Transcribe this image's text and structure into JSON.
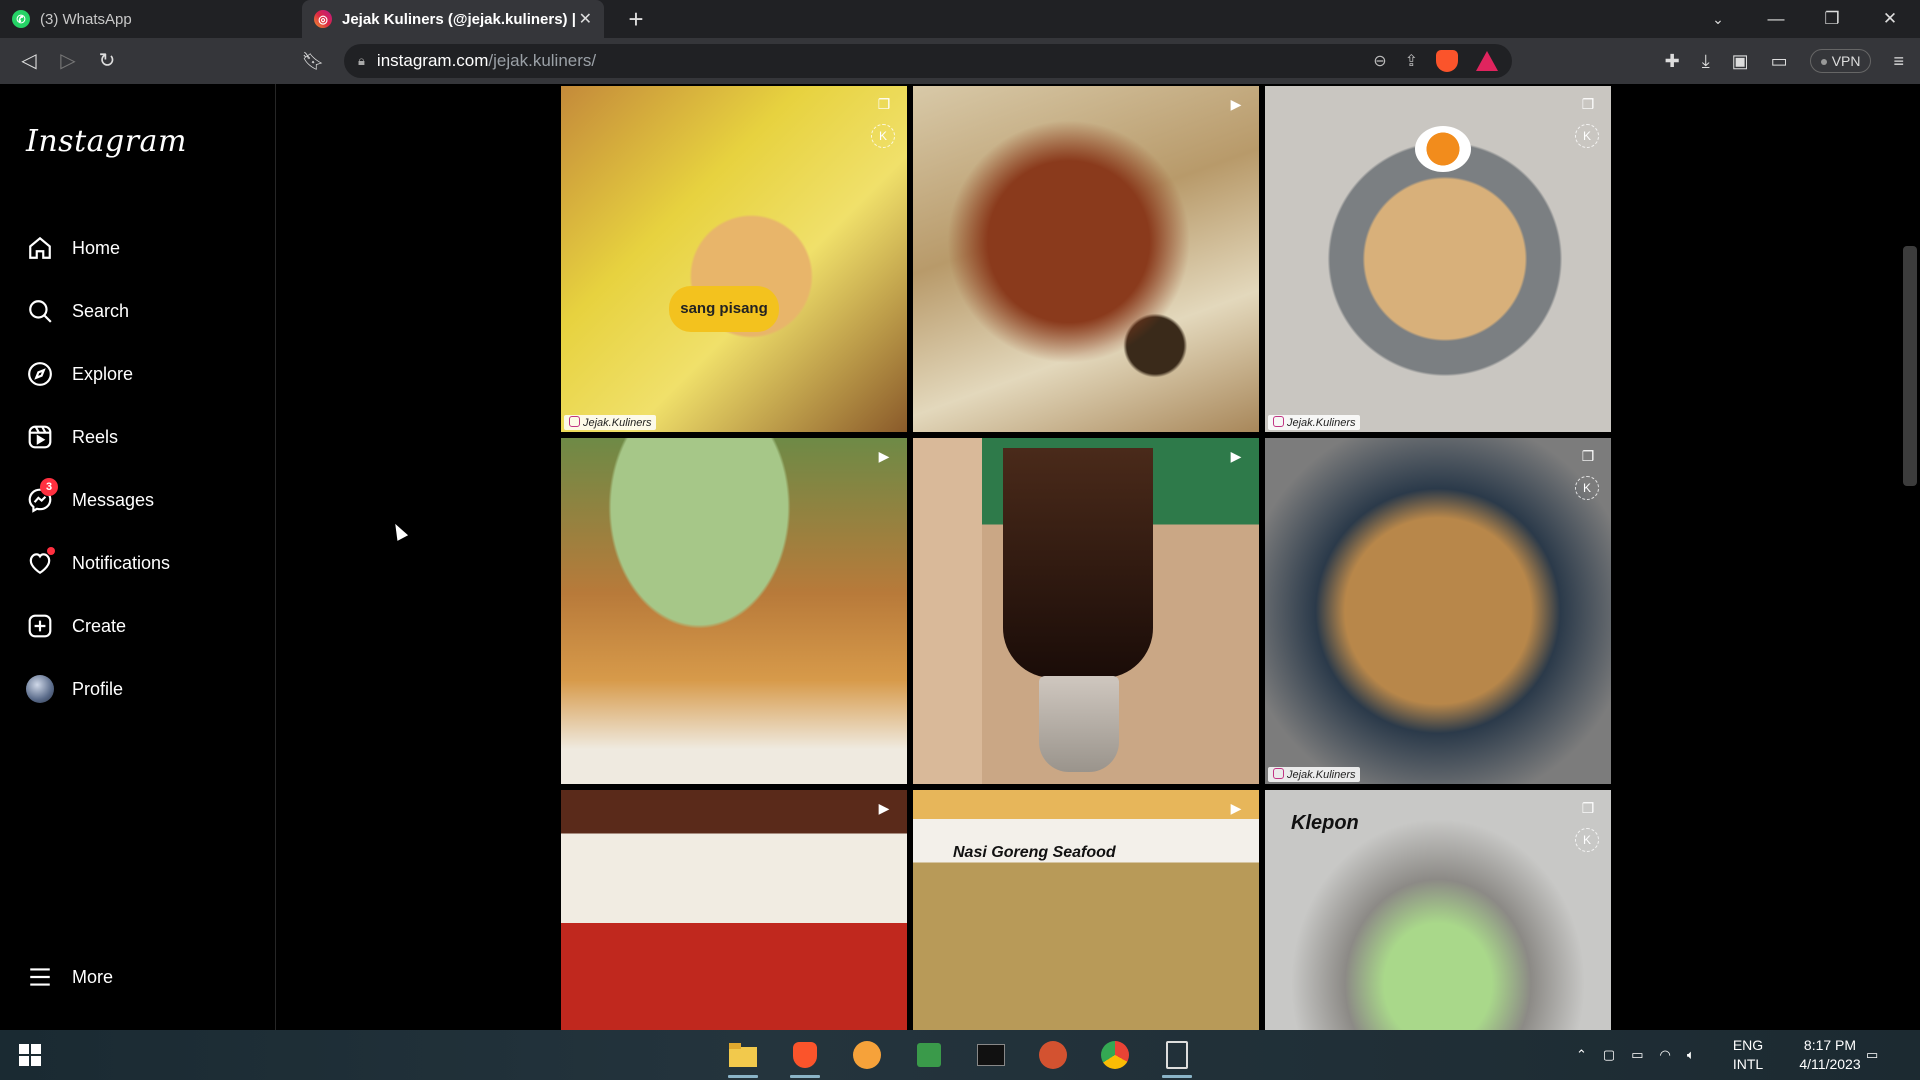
{
  "browser": {
    "tabs": [
      {
        "title": "(3) WhatsApp",
        "icon": "whatsapp-icon",
        "active": false
      },
      {
        "title": "Jejak Kuliners (@jejak.kuliners) | I",
        "icon": "instagram-icon",
        "active": true
      }
    ],
    "url_host": "instagram.com",
    "url_path": "/jejak.kuliners/",
    "vpn_label": "VPN"
  },
  "sidebar": {
    "logo": "Instagram",
    "items": [
      {
        "label": "Home",
        "icon": "home-icon"
      },
      {
        "label": "Search",
        "icon": "search-icon"
      },
      {
        "label": "Explore",
        "icon": "compass-icon"
      },
      {
        "label": "Reels",
        "icon": "reels-icon"
      },
      {
        "label": "Messages",
        "icon": "messenger-icon",
        "badge": "3"
      },
      {
        "label": "Notifications",
        "icon": "heart-icon"
      },
      {
        "label": "Create",
        "icon": "plus-square-icon"
      },
      {
        "label": "Profile",
        "icon": "avatar"
      },
      {
        "label": "More",
        "icon": "menu-icon"
      }
    ]
  },
  "posts": [
    {
      "type": "carousel",
      "watermark": "Jejak.Kuliners",
      "caption": "",
      "label_text": "sang pisang"
    },
    {
      "type": "reel",
      "watermark": "",
      "caption": ""
    },
    {
      "type": "carousel",
      "watermark": "Jejak.Kuliners",
      "caption": ""
    },
    {
      "type": "reel",
      "watermark": "",
      "caption": ""
    },
    {
      "type": "reel",
      "watermark": "",
      "caption": ""
    },
    {
      "type": "carousel",
      "watermark": "Jejak.Kuliners",
      "caption": ""
    },
    {
      "type": "reel",
      "watermark": "",
      "caption": ""
    },
    {
      "type": "reel",
      "watermark": "",
      "caption": "Nasi Goreng Seafood"
    },
    {
      "type": "carousel",
      "watermark": "",
      "caption": "Klepon"
    }
  ],
  "watermark_mark": "K",
  "taskbar": {
    "lang_top": "ENG",
    "lang_bottom": "INTL",
    "time": "8:17 PM",
    "date": "4/11/2023"
  },
  "colors": {
    "instagram_accent": "#ff3040",
    "brave_orange": "#fb542b"
  }
}
